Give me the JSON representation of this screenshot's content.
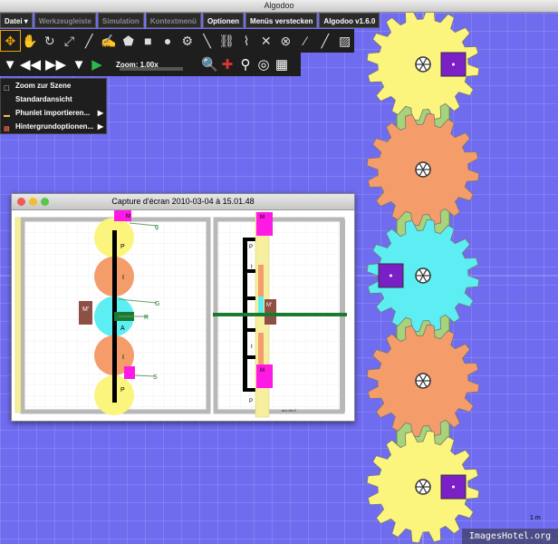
{
  "window": {
    "title": "Algodoo"
  },
  "menubar": {
    "items": [
      {
        "label": "Datei ▾",
        "dim": false
      },
      {
        "label": "Werkzeugleiste",
        "dim": true
      },
      {
        "label": "Simulation",
        "dim": true
      },
      {
        "label": "Kontextmenü",
        "dim": true
      },
      {
        "label": "Optionen",
        "dim": false
      },
      {
        "label": "Menüs verstecken",
        "dim": false
      },
      {
        "label": "Algodoo v1.6.0",
        "dim": false
      }
    ]
  },
  "toolbar": {
    "tools": [
      {
        "name": "move-tool-icon",
        "glyph": "✥"
      },
      {
        "name": "hand-tool-icon",
        "glyph": "✋"
      },
      {
        "name": "rotate-tool-icon",
        "glyph": "↻"
      },
      {
        "name": "scale-tool-icon",
        "glyph": "⤢"
      },
      {
        "name": "knife-tool-icon",
        "glyph": "╱"
      },
      {
        "name": "brush-tool-icon",
        "glyph": "✍"
      },
      {
        "name": "polygon-tool-icon",
        "glyph": "⬟"
      },
      {
        "name": "box-tool-icon",
        "glyph": "■"
      },
      {
        "name": "circle-tool-icon",
        "glyph": "●"
      },
      {
        "name": "gear-tool-icon",
        "glyph": "⚙"
      },
      {
        "name": "plane-tool-icon",
        "glyph": "╲"
      },
      {
        "name": "chain-tool-icon",
        "glyph": "⛓"
      },
      {
        "name": "spring-tool-icon",
        "glyph": "⌇"
      },
      {
        "name": "fixate-tool-icon",
        "glyph": "✕"
      },
      {
        "name": "wheel-tool-icon",
        "glyph": "⊗"
      },
      {
        "name": "laser-tool-icon",
        "glyph": "⁄"
      },
      {
        "name": "tracer-tool-icon",
        "glyph": "╱"
      },
      {
        "name": "texture-tool-icon",
        "glyph": "▨"
      }
    ]
  },
  "sim_controls": {
    "zoom_label": "Zoom: 1.00x"
  },
  "popup_menu": {
    "items": [
      {
        "label": "Zoom zur Szene",
        "arrow": "",
        "icon": "zoom-scene-icon"
      },
      {
        "label": "Standardansicht",
        "arrow": "",
        "icon": "default-view-icon"
      },
      {
        "label": "Phunlet importieren...",
        "arrow": "▶",
        "icon": "folder-icon"
      },
      {
        "label": "Hintergrundoptionen...",
        "arrow": "▶",
        "icon": "rainbow-icon"
      }
    ]
  },
  "screenshot_window": {
    "title": "Capture d'écran 2010-03-04 à 15.01.48"
  },
  "labels": {
    "p_top": "P",
    "i_top": "I",
    "m_left": "M'",
    "g": "G",
    "r": "R",
    "a": "A",
    "i_bot": "I",
    "p_bot": "P",
    "s": "S",
    "g_top": "g",
    "m_top": "M",
    "side_m_top": "M",
    "side_p_top": "P",
    "side_i_top": "I",
    "side_m_mid": "M'",
    "side_i_bot": "I",
    "side_m_bot": "M",
    "side_p_bot": "P",
    "side_note": "acc.der.2"
  },
  "scale_label": "1 m",
  "watermark": "ImagesHotel.org",
  "colors": {
    "yellow": "#fbf57e",
    "orange": "#f59c6b",
    "cyan": "#5ceef2",
    "purple": "#7b1fc6",
    "canvas": "#6f6cf0"
  }
}
